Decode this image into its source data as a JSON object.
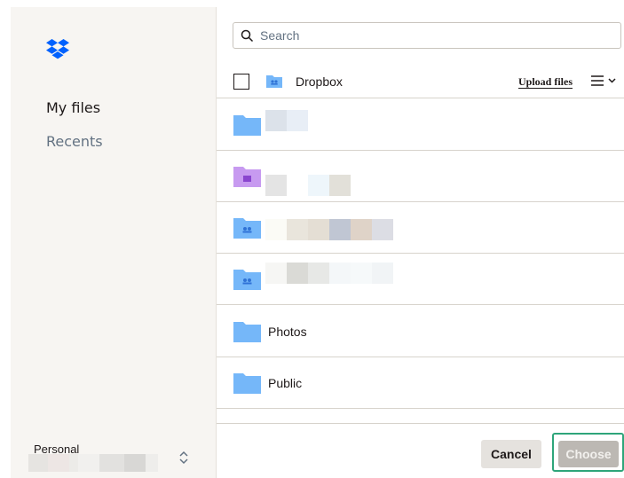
{
  "sidebar": {
    "nav": [
      {
        "label": "My files"
      },
      {
        "label": "Recents"
      }
    ],
    "account": {
      "label": "Personal"
    }
  },
  "search": {
    "placeholder": "Search",
    "value": ""
  },
  "header": {
    "folder_title": "Dropbox",
    "upload_label": "Upload files"
  },
  "rows": [
    {
      "icon": "folder-icon",
      "name": ""
    },
    {
      "icon": "folder-photo-icon",
      "name": ""
    },
    {
      "icon": "shared-folder-icon",
      "name": ""
    },
    {
      "icon": "shared-folder-icon",
      "name": ""
    },
    {
      "icon": "folder-icon",
      "name": "Photos"
    },
    {
      "icon": "folder-icon",
      "name": "Public"
    }
  ],
  "footer": {
    "cancel_label": "Cancel",
    "choose_label": "Choose"
  },
  "colors": {
    "accent": "#0061fe",
    "folder": "#75b7f9",
    "focus_ring": "#2ea57a"
  }
}
